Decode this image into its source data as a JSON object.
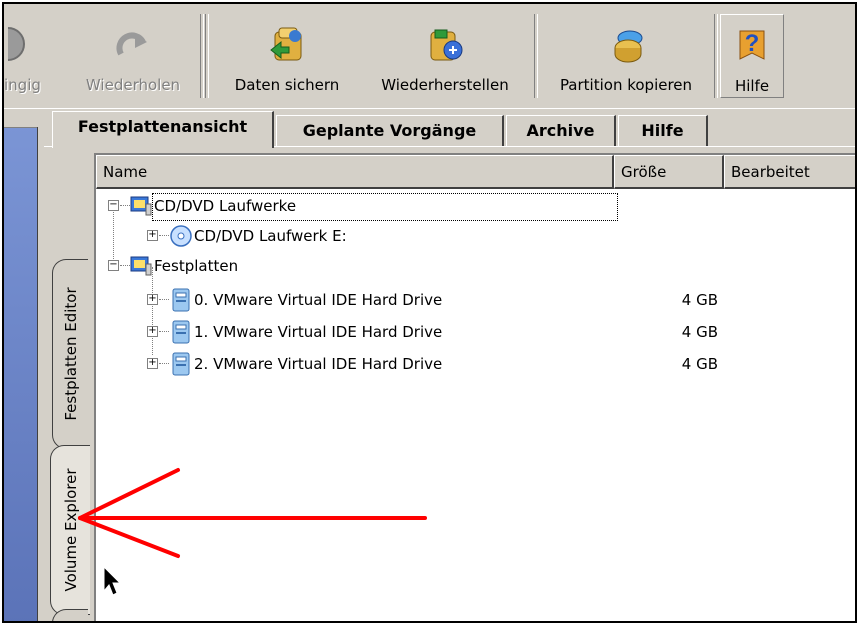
{
  "toolbar": {
    "buttons": [
      {
        "label": "ingig",
        "state": "disabled",
        "icon": "redo-partial-icon"
      },
      {
        "label": "Wiederholen",
        "state": "disabled",
        "icon": "redo-arrow-icon"
      },
      {
        "label": "Daten sichern",
        "state": "normal",
        "icon": "backup-icon"
      },
      {
        "label": "Wiederherstellen",
        "state": "normal",
        "icon": "restore-icon"
      },
      {
        "label": "Partition kopieren",
        "state": "normal",
        "icon": "copy-partition-icon"
      },
      {
        "label": "Hilfe",
        "state": "normal",
        "icon": "help-icon"
      }
    ]
  },
  "tabs": [
    {
      "label": "Festplattenansicht",
      "active": true
    },
    {
      "label": "Geplante Vorgänge",
      "active": false
    },
    {
      "label": "Archive",
      "active": false
    },
    {
      "label": "Hilfe",
      "active": false
    }
  ],
  "side_tabs": [
    {
      "label": "Festplatten Editor",
      "active": false
    },
    {
      "label": "Volume Explorer",
      "active": true
    }
  ],
  "columns": {
    "name": "Name",
    "size": "Größe",
    "modified": "Bearbeitet"
  },
  "tree": [
    {
      "label": "CD/DVD Laufwerke",
      "icon": "computer-icon",
      "level": 0,
      "expanded": true,
      "size": ""
    },
    {
      "label": "CD/DVD Laufwerk E:",
      "icon": "cd-drive-icon",
      "level": 1,
      "expanded": false,
      "size": ""
    },
    {
      "label": "Festplatten",
      "icon": "computer-icon",
      "level": 0,
      "expanded": true,
      "size": ""
    },
    {
      "label": "0. VMware Virtual IDE Hard Drive",
      "icon": "hard-drive-icon",
      "level": 1,
      "expanded": false,
      "size": "4 GB"
    },
    {
      "label": "1. VMware Virtual IDE Hard Drive",
      "icon": "hard-drive-icon",
      "level": 1,
      "expanded": false,
      "size": "4 GB"
    },
    {
      "label": "2. VMware Virtual IDE Hard Drive",
      "icon": "hard-drive-icon",
      "level": 1,
      "expanded": false,
      "size": "4 GB"
    }
  ],
  "colors": {
    "accent_arrow": "#ff0000",
    "side_panel": "#6f89c8",
    "chrome": "#d4d0c8"
  }
}
